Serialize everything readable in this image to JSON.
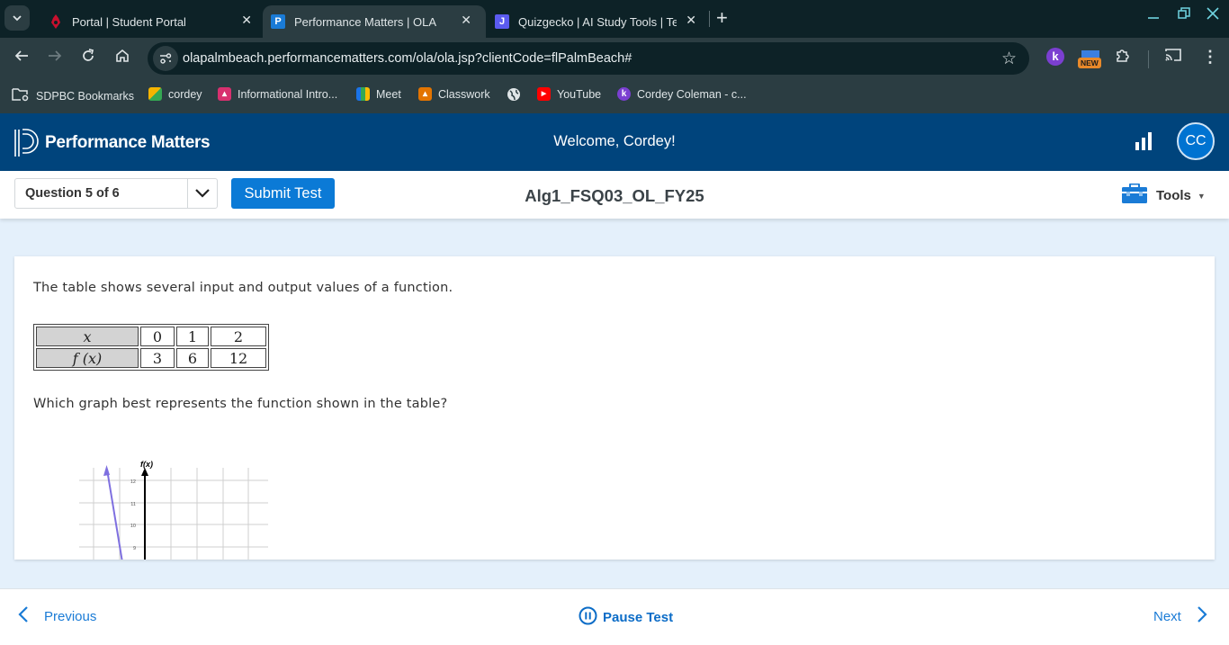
{
  "browser": {
    "tabs": [
      {
        "title": "Portal | Student Portal",
        "icon": "portal-favicon-icon",
        "color": "#c8102e",
        "active": false
      },
      {
        "title": "Performance Matters | OLA",
        "icon": "performance-matters-favicon-icon",
        "color": "#1a7bd6",
        "active": true
      },
      {
        "title": "Quizgecko | AI Study Tools | Test",
        "icon": "quizgecko-favicon-icon",
        "color": "#5b5bf0",
        "active": false
      }
    ],
    "new_tab_label": "+",
    "url": "olapalmbeach.performancematters.com/ola/ola.jsp?clientCode=flPalmBeach#",
    "extensions": [
      {
        "name": "kami-extension",
        "label": "k"
      },
      {
        "name": "new-extension",
        "badge": "NEW"
      }
    ],
    "bookmarks": [
      {
        "label": "SDPBC Bookmarks",
        "icon": "folder-icon"
      },
      {
        "label": "cordey",
        "icon": "cube-icon"
      },
      {
        "label": "Informational Intro...",
        "icon": "classroom-icon"
      },
      {
        "label": "Meet",
        "icon": "meet-icon"
      },
      {
        "label": "Classwork",
        "icon": "classwork-icon"
      },
      {
        "label": "",
        "icon": "globe-icon"
      },
      {
        "label": "YouTube",
        "icon": "youtube-icon"
      },
      {
        "label": "Cordey Coleman - c...",
        "icon": "kami-icon"
      }
    ]
  },
  "app": {
    "brand": "Performance Matters",
    "welcome": "Welcome, Cordey!",
    "avatar_initials": "CC",
    "brand_color": "#00447c",
    "accent_color": "#0b7ad6"
  },
  "test_bar": {
    "question_selector": "Question 5 of 6",
    "submit_label": "Submit Test",
    "test_title": "Alg1_FSQ03_OL_FY25",
    "tools_label": "Tools"
  },
  "question": {
    "intro": "The table shows several input and output values of a function.",
    "table": {
      "row_headers": [
        "x",
        "f (x)"
      ],
      "x_values": [
        "0",
        "1",
        "2"
      ],
      "fx_values": [
        "3",
        "6",
        "12"
      ]
    },
    "prompt": "Which graph best represents the function shown in the table?",
    "graph": {
      "y_axis_label": "f(x)",
      "y_tick_labels": [
        "12",
        "11",
        "10",
        "9"
      ]
    }
  },
  "footer": {
    "previous_label": "Previous",
    "pause_label": "Pause Test",
    "next_label": "Next"
  }
}
